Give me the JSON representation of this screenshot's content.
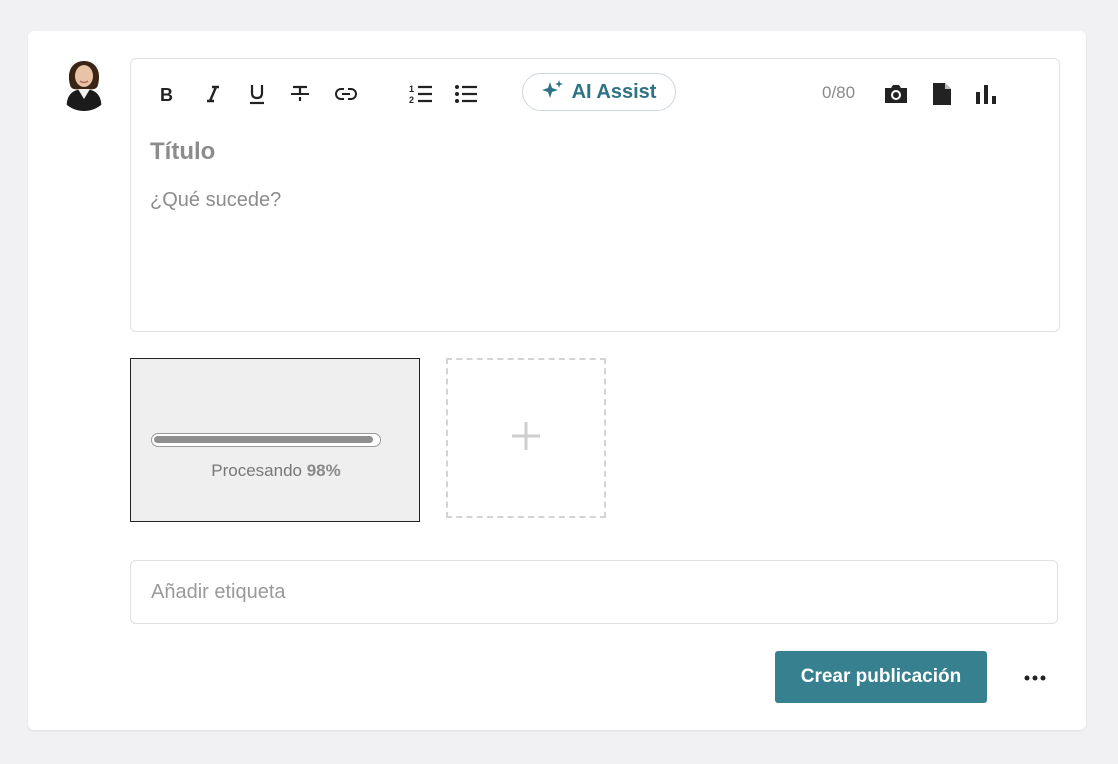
{
  "composer": {
    "toolbar": {
      "ai_assist_label": "AI Assist",
      "char_counter": "0/80"
    },
    "title_placeholder": "Título",
    "body_placeholder": "¿Qué sucede?",
    "upload": {
      "status_label": "Procesando",
      "percent_label": "98%",
      "progress": 0.98
    },
    "tag_placeholder": "Añadir etiqueta",
    "submit_label": "Crear publicación"
  },
  "colors": {
    "accent": "#37808f",
    "ai_text": "#2e7384"
  }
}
